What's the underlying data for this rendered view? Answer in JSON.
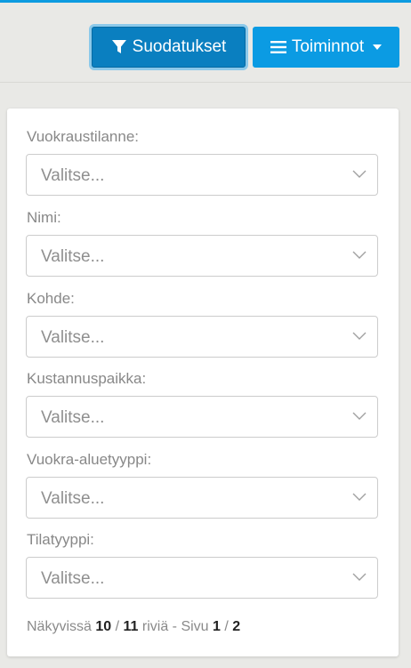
{
  "toolbar": {
    "filter_label": "Suodatukset",
    "actions_label": "Toiminnot",
    "filter_icon": "filter-icon",
    "actions_icon": "menu-icon",
    "caret_icon": "caret-down-icon"
  },
  "filters": [
    {
      "label": "Vuokraustilanne:",
      "placeholder": "Valitse..."
    },
    {
      "label": "Nimi:",
      "placeholder": "Valitse..."
    },
    {
      "label": "Kohde:",
      "placeholder": "Valitse..."
    },
    {
      "label": "Kustannuspaikka:",
      "placeholder": "Valitse..."
    },
    {
      "label": "Vuokra-aluetyyppi:",
      "placeholder": "Valitse..."
    },
    {
      "label": "Tilatyyppi:",
      "placeholder": "Valitse..."
    }
  ],
  "status": {
    "prefix": "Näkyvissä",
    "visible": "10",
    "sep1": "/",
    "total": "11",
    "rows_word": "riviä - Sivu",
    "page": "1",
    "sep2": "/",
    "pages": "2"
  },
  "colors": {
    "accent": "#0b9be3",
    "active_button": "#0a7fc0"
  }
}
